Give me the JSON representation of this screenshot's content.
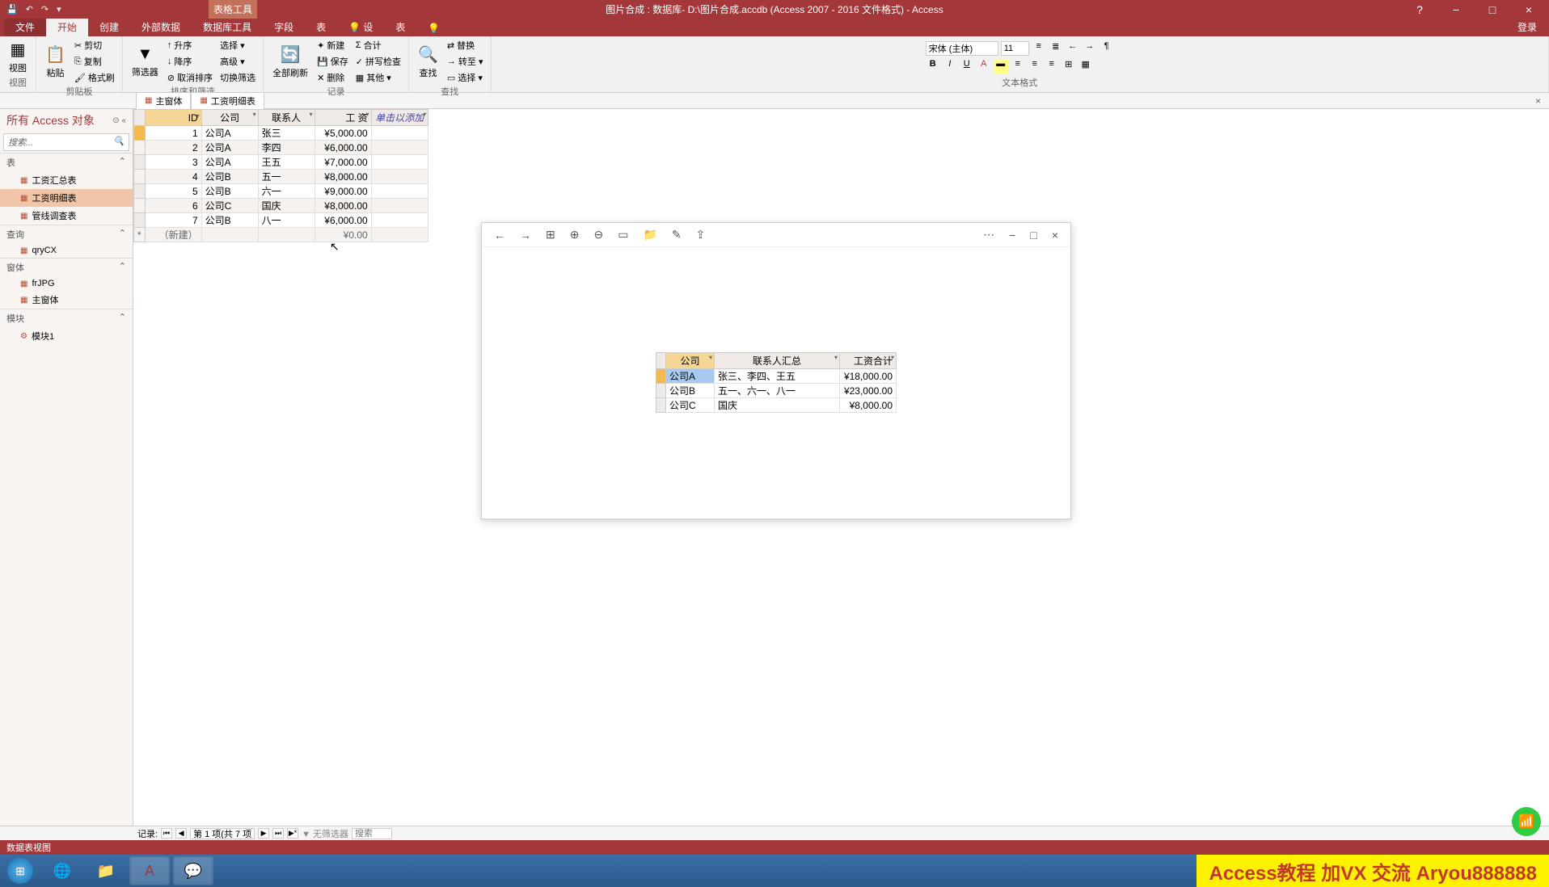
{
  "titlebar": {
    "contextual_label": "表格工具",
    "title": "图片合成 : 数据库- D:\\图片合成.accdb (Access 2007 - 2016 文件格式) - Access",
    "help": "?",
    "minimize": "−",
    "maximize": "□",
    "close": "×"
  },
  "ribbon_tabs": {
    "file": "文件",
    "home": "开始",
    "create": "创建",
    "external": "外部数据",
    "dbtools": "数据库工具",
    "field": "字段",
    "table": "表",
    "tell1": "设",
    "tell2": "表",
    "tell3": "",
    "login": "登录"
  },
  "ribbon": {
    "view": "视图",
    "paste": "粘贴",
    "cut": "剪切",
    "copy": "复制",
    "format_painter": "格式刷",
    "clipboard_label": "剪贴板",
    "filter": "筛选器",
    "ascending": "升序",
    "descending": "降序",
    "remove_sort": "取消排序",
    "selection": "选择 ▾",
    "advanced": "高级 ▾",
    "toggle_filter": "切换筛选",
    "sort_label": "排序和筛选",
    "refresh_all": "全部刷新",
    "new_rec": "新建",
    "save_rec": "保存",
    "delete_rec": "删除",
    "totals": "合计",
    "spelling": "拼写检查",
    "more": "其他 ▾",
    "records_label": "记录",
    "find": "查找",
    "replace": "替换",
    "goto": "转至 ▾",
    "select": "选择 ▾",
    "find_label": "查找",
    "font_name": "宋体 (主体)",
    "font_size": "11",
    "textfmt_label": "文本格式"
  },
  "doc_tabs": {
    "tab1": "主窗体",
    "tab2": "工资明细表"
  },
  "nav": {
    "header": "所有 Access 对象",
    "search_placeholder": "搜索...",
    "section_tables": "表",
    "item_summary_table": "工资汇总表",
    "item_detail_table": "工资明细表",
    "item_pipeline_table": "管线调查表",
    "section_queries": "查询",
    "item_query": "qryCX",
    "section_forms": "窗体",
    "item_frjpg": "frJPG",
    "item_mainform": "主窗体",
    "section_modules": "模块",
    "item_module1": "模块1"
  },
  "datasheet": {
    "col_id": "ID",
    "col_company": "公司",
    "col_contact": "联系人",
    "col_salary": "工 资",
    "col_add": "单击以添加",
    "rows": [
      {
        "id": "1",
        "company": "公司A",
        "contact": "张三",
        "salary": "¥5,000.00"
      },
      {
        "id": "2",
        "company": "公司A",
        "contact": "李四",
        "salary": "¥6,000.00"
      },
      {
        "id": "3",
        "company": "公司A",
        "contact": "王五",
        "salary": "¥7,000.00"
      },
      {
        "id": "4",
        "company": "公司B",
        "contact": "五一",
        "salary": "¥8,000.00"
      },
      {
        "id": "5",
        "company": "公司B",
        "contact": "六一",
        "salary": "¥9,000.00"
      },
      {
        "id": "6",
        "company": "公司C",
        "contact": "国庆",
        "salary": "¥8,000.00"
      },
      {
        "id": "7",
        "company": "公司B",
        "contact": "八一",
        "salary": "¥6,000.00"
      }
    ],
    "new_row_label": "（新建）",
    "new_row_salary": "¥0.00"
  },
  "record_nav": {
    "label": "记录:",
    "position": "第 1 项(共 7 项)",
    "no_filter": "无筛选器",
    "search": "搜索"
  },
  "statusbar": {
    "text": "数据表视图"
  },
  "viewer": {
    "col_company": "公司",
    "col_contacts": "联系人汇总",
    "col_total": "工资合计",
    "rows": [
      {
        "company": "公司A",
        "contacts": "张三、李四、王五",
        "total": "¥18,000.00"
      },
      {
        "company": "公司B",
        "contacts": "五一、六一、八一",
        "total": "¥23,000.00"
      },
      {
        "company": "公司C",
        "contacts": "国庆",
        "total": "¥8,000.00"
      }
    ]
  },
  "tutorial_banner": "Access教程 加VX 交流 Aryou888888"
}
